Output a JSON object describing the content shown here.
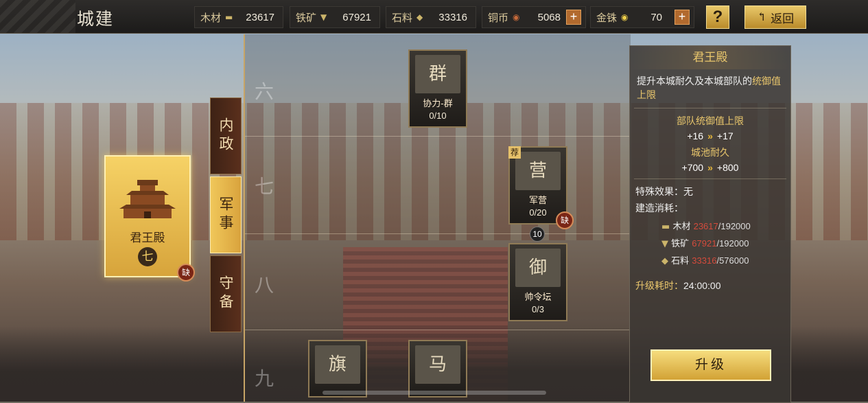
{
  "page_title": "城建",
  "resources": [
    {
      "label": "木材",
      "icon": "wood-icon",
      "value": "23617",
      "plus": false
    },
    {
      "label": "铁矿",
      "icon": "anvil-icon",
      "value": "67921",
      "plus": false
    },
    {
      "label": "石料",
      "icon": "stone-icon",
      "value": "33316",
      "plus": false
    },
    {
      "label": "铜币",
      "icon": "copper-coin-icon",
      "value": "5068",
      "plus": true
    },
    {
      "label": "金铢",
      "icon": "gold-coin-icon",
      "value": "70",
      "plus": true
    }
  ],
  "help_label": "?",
  "back_label": "返回",
  "selected_building": {
    "name": "君王殿",
    "level": "七",
    "badge": "缺"
  },
  "tabs": [
    {
      "label": "内政",
      "active": false
    },
    {
      "label": "军事",
      "active": true
    },
    {
      "label": "守备",
      "active": false
    }
  ],
  "tiers": [
    "六",
    "七",
    "八",
    "九"
  ],
  "nodes": {
    "xieli": {
      "icon_text": "群",
      "name": "协力-群",
      "count": "0/10"
    },
    "junying": {
      "icon_text": "营",
      "name": "军营",
      "count": "0/20",
      "tag": "荐",
      "badge": "缺"
    },
    "shuailing": {
      "icon_text": "御",
      "name": "帅令坛",
      "count": "0/3",
      "req": "10"
    },
    "b1": {
      "icon_text": "旗"
    },
    "b2": {
      "icon_text": "马"
    }
  },
  "info": {
    "title": "君王殿",
    "desc_plain": "提升本城耐久及本城部队的",
    "desc_hl": "统御值上限",
    "stats": [
      {
        "label": "部队统御值上限",
        "from": "+16",
        "to": "+17"
      },
      {
        "label": "城池耐久",
        "from": "+700",
        "to": "+800"
      }
    ],
    "special_label": "特殊效果：",
    "special_value": "无",
    "cost_label": "建造消耗：",
    "costs": [
      {
        "name": "木材",
        "have": "23617",
        "need": "/192000"
      },
      {
        "name": "铁矿",
        "have": "67921",
        "need": "/192000"
      },
      {
        "name": "石料",
        "have": "33316",
        "need": "/576000"
      }
    ],
    "time_label": "升级耗时：",
    "time_value": "24:00:00"
  },
  "upgrade_label": "升级",
  "colors": {
    "gold": "#e9c66c",
    "red": "#d34b3c",
    "panel": "#3a3632"
  }
}
